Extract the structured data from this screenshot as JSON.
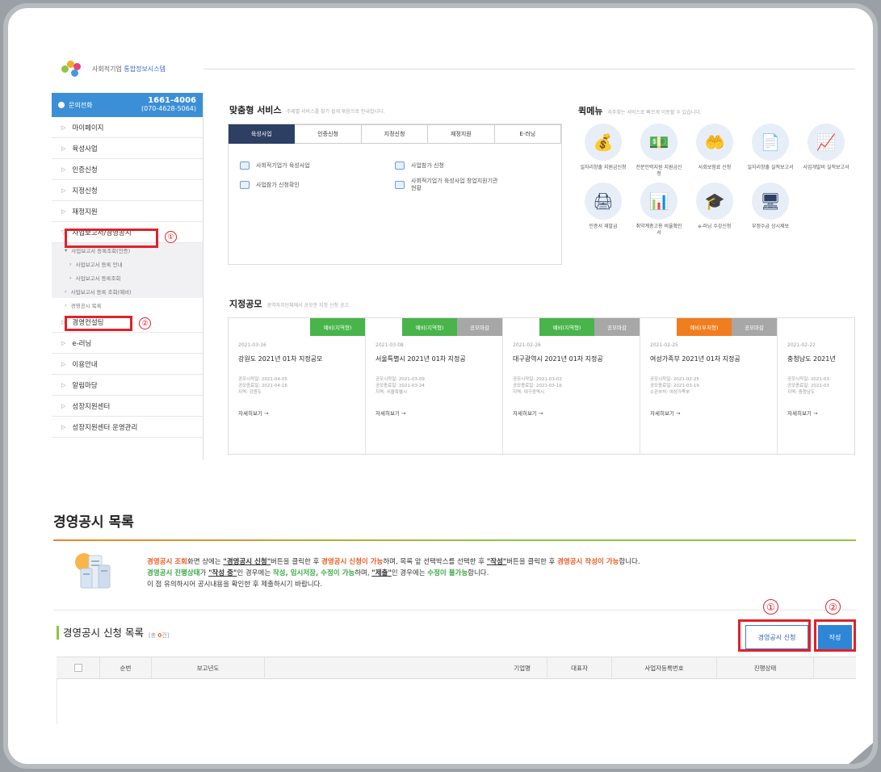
{
  "logo": {
    "text_prefix": "사회적기업",
    "text_main": "통합정보시스템"
  },
  "sidebar": {
    "call_label": "문의전화",
    "phone_main": "1661-4006",
    "phone_sub": "(070-4628-5064)",
    "items": [
      {
        "label": "마이페이지"
      },
      {
        "label": "육성사업"
      },
      {
        "label": "인증신청"
      },
      {
        "label": "지정신청"
      },
      {
        "label": "재정지원"
      },
      {
        "label": "사업보고서/경영공시"
      }
    ],
    "sub_items": [
      {
        "label": "사업보고서 등록조회(인증)"
      },
      {
        "label": "사업보고서 등록 안내"
      },
      {
        "label": "사업보고서 등록조회"
      },
      {
        "label": "사업보고서 등록 조회(예비)"
      },
      {
        "label": "경영공시 목록"
      }
    ],
    "items_after": [
      {
        "label": "경영컨설팅"
      },
      {
        "label": "e-러닝"
      },
      {
        "label": "이용안내"
      },
      {
        "label": "알림마당"
      },
      {
        "label": "성장지원센터"
      },
      {
        "label": "성장지원센터 운영관리"
      }
    ]
  },
  "custom_service": {
    "title": "맞춤형 서비스",
    "subtitle": "주제별 서비스를 찾기 쉽게 묶음으로 안내합니다.",
    "tabs": [
      "육성사업",
      "인증신청",
      "지정신청",
      "재정지원",
      "E-러닝"
    ],
    "links": [
      "사회적기업가 육성사업",
      "사업참가 신청",
      "사업참가 신청확인",
      "사회적기업가 육성사업 창업지원기관 현황"
    ]
  },
  "quick_menu": {
    "title": "퀵메뉴",
    "subtitle": "자주찾는 서비스로 빠르게 이동할 수 있습니다.",
    "items": [
      {
        "label": "일자리창출 지원금신청",
        "icon": "money-bag-icon",
        "glyph": "💰"
      },
      {
        "label": "전문인력지원 지원금신청",
        "icon": "cash-icon",
        "glyph": "💵"
      },
      {
        "label": "사회보험료 신청",
        "icon": "hand-coin-icon",
        "glyph": "🤲"
      },
      {
        "label": "일자리창출 실적보고서",
        "icon": "document-icon",
        "glyph": "📄"
      },
      {
        "label": "사업개발비 실적보고서",
        "icon": "chart-report-icon",
        "glyph": "📈"
      },
      {
        "label": "인증서 재발급",
        "icon": "printer-icon",
        "glyph": "🖨"
      },
      {
        "label": "취약계층고용 비율확인서",
        "icon": "presentation-icon",
        "glyph": "📊"
      },
      {
        "label": "e-러닝 수강신청",
        "icon": "graduation-cap-icon",
        "glyph": "🎓"
      },
      {
        "label": "부정수급 상시제보",
        "icon": "monitor-icon",
        "glyph": "🖥"
      }
    ]
  },
  "designation_notice": {
    "title": "지정공모",
    "subtitle": "광역자치단체에서 공모한 지정 신청 공고",
    "cards": [
      {
        "badges": [
          {
            "text": "예비(지역형)",
            "type": "green"
          }
        ],
        "date": "2021-03-16",
        "title": "강원도 2021년 01차 지정공모",
        "start": "공모시작일: 2021-04-05",
        "end": "공모종료일: 2021-04-16",
        "region": "지역: 강원도",
        "more": "자세히보기 →"
      },
      {
        "badges": [
          {
            "text": "예비(지역형)",
            "type": "green"
          },
          {
            "text": "공모마감",
            "type": "grey"
          }
        ],
        "date": "2021-03-08",
        "title": "서울특별시 2021년 01차 지정공",
        "start": "공모시작일: 2021-03-09",
        "end": "공모종료일: 2021-03-24",
        "region": "지역: 서울특별시",
        "more": "자세히보기 →"
      },
      {
        "badges": [
          {
            "text": "예비(지역형)",
            "type": "green"
          },
          {
            "text": "공모마감",
            "type": "grey"
          }
        ],
        "date": "2021-02-26",
        "title": "대구광역시 2021년 01차 지정공",
        "start": "공모시작일: 2021-03-02",
        "end": "공모종료일: 2021-03-16",
        "region": "지역: 대구광역시",
        "more": "자세히보기 →"
      },
      {
        "badges": [
          {
            "text": "예비(부처형)",
            "type": "orange"
          },
          {
            "text": "공모마감",
            "type": "grey"
          }
        ],
        "date": "2021-02-25",
        "title": "여성가족부 2021년 01차 지정공",
        "start": "공모시작일: 2021-02-25",
        "end": "공모종료일: 2021-03-19",
        "region": "소관부처: 여성가족부",
        "more": "자세히보기 →"
      },
      {
        "badges": [],
        "date": "2021-02-22",
        "title": "충청남도 2021년",
        "start": "공모시작일: 2021-03",
        "end": "공모종료일: 2021-03",
        "region": "지역: 충청남도",
        "more": "자세히보기 →"
      }
    ]
  },
  "page": {
    "title": "경영공시 목록",
    "info_line1": {
      "a": "경영공시 조회",
      "b": "화면 상에는 ",
      "c": "\"경영공시 신청\"",
      "d": "버튼을 클릭한 후 ",
      "e": "경영공시 신청이 가능",
      "f": "하며, 목록 앞 선택박스를 선택한 후 ",
      "g": "\"작성\"",
      "h": "버튼을 클릭한 후 ",
      "i": "경영공시 작성이 가능",
      "j": "합니다."
    },
    "info_line2": {
      "a": "경영공시 진행상태",
      "b": "가 ",
      "c": "\"작성 중\"",
      "d": "인 경우에는 ",
      "e": "작성, 임시저장, 수정이 가능",
      "f": "하며, ",
      "g": "\"제출\"",
      "h": "인 경우에는 ",
      "i": "수정이 불가능",
      "j": "합니다."
    },
    "info_line3": "이 점 유의하시어 공시내용을 확인한 후 제출하시기 바랍니다.",
    "list_title": "경영공시 신청 목록",
    "count_prefix": "[총 ",
    "count_value": "0",
    "count_suffix": "건]",
    "btn_apply": "경영공시 신청",
    "btn_write": "작성",
    "columns": [
      "순번",
      "보고년도",
      "기업명",
      "대표자",
      "사업자등록번호",
      "진행상태"
    ]
  },
  "annotations": {
    "one": "①",
    "two": "②"
  },
  "colors": {
    "highlight": "#e0212b",
    "accent_blue": "#2e86d6",
    "nav_dark": "#2d3f63",
    "green": "#48b44a",
    "orange": "#f07d1e"
  }
}
